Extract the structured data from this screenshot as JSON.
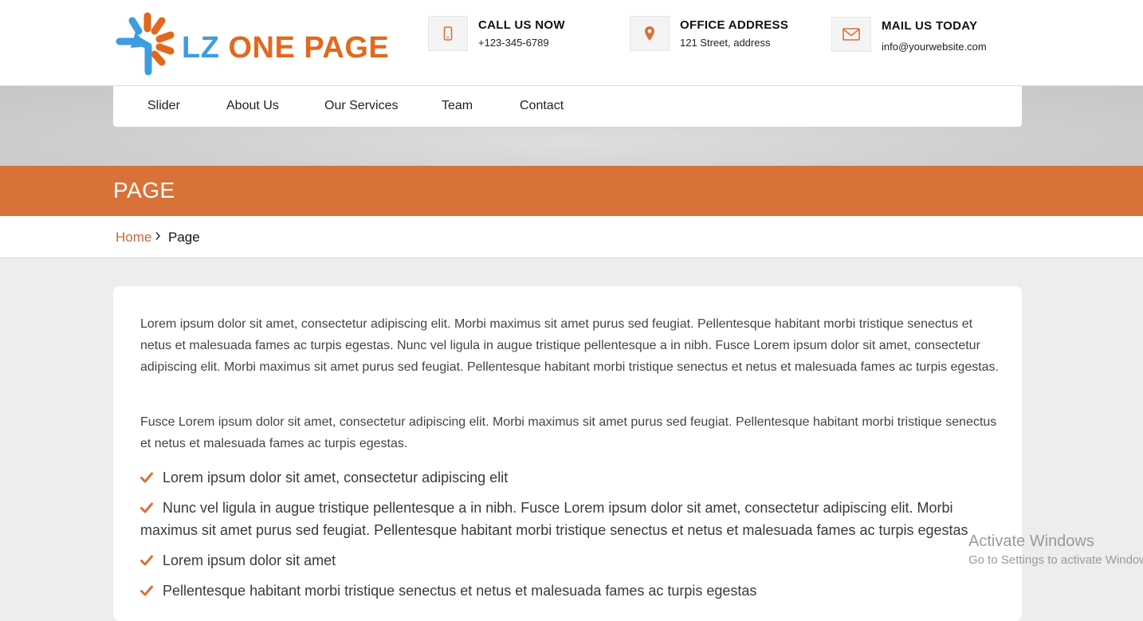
{
  "header": {
    "logo_lz": "LZ",
    "logo_rest": "ONE PAGE",
    "contacts": [
      {
        "icon": "mobile-phone-icon",
        "title": "CALL US NOW",
        "value": "+123-345-6789"
      },
      {
        "icon": "map-pin-icon",
        "title": "OFFICE ADDRESS",
        "value": "121 Street, address"
      },
      {
        "icon": "envelope-icon",
        "title": "MAIL US TODAY",
        "value": "info@yourwebsite.com"
      }
    ]
  },
  "nav": {
    "items": [
      "Slider",
      "About Us",
      "Our Services",
      "Team",
      "Contact"
    ]
  },
  "page": {
    "title": "PAGE",
    "breadcrumb": {
      "home": "Home",
      "current": "Page"
    }
  },
  "content": {
    "paragraphs": [
      "Lorem ipsum dolor sit amet, consectetur adipiscing elit. Morbi maximus sit amet purus sed feugiat. Pellentesque habitant morbi tristique senectus et netus et malesuada fames ac turpis egestas. Nunc vel ligula in augue tristique pellentesque a in nibh. Fusce Lorem ipsum dolor sit amet, consectetur adipiscing elit. Morbi maximus sit amet purus sed feugiat. Pellentesque habitant morbi tristique senectus et netus et malesuada fames ac turpis egestas.",
      "Fusce Lorem ipsum dolor sit amet, consectetur adipiscing elit. Morbi maximus sit amet purus sed feugiat. Pellentesque habitant morbi tristique senectus et netus et malesuada fames ac turpis egestas."
    ],
    "list": [
      "Lorem ipsum dolor sit amet, consectetur adipiscing elit",
      "Nunc vel ligula in augue tristique pellentesque a in nibh. Fusce Lorem ipsum dolor sit amet, consectetur adipiscing elit. Morbi maximus sit amet purus sed feugiat. Pellentesque habitant morbi tristique senectus et netus et malesuada fames ac turpis egestas",
      "Lorem ipsum dolor sit amet",
      "Pellentesque habitant morbi tristique senectus et netus et malesuada fames ac turpis egestas"
    ]
  },
  "watermark": {
    "line1": "Activate Windows",
    "line2": "Go to Settings to activate Windows."
  },
  "colors": {
    "accent": "#d87238",
    "logo_blue": "#3d9de0",
    "logo_orange": "#e3681c"
  }
}
